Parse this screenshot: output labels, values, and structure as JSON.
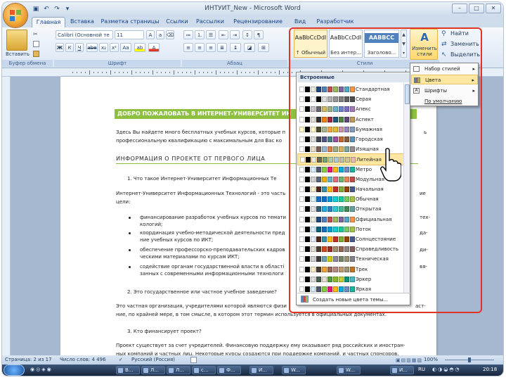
{
  "window": {
    "title": "ИНТУИТ_New - Microsoft Word"
  },
  "tabs": [
    "Главная",
    "Вставка",
    "Разметка страницы",
    "Ссылки",
    "Рассылки",
    "Рецензирование",
    "Вид",
    "Разработчик"
  ],
  "ribbon": {
    "paste_label": "Вставить",
    "clipboard_group": "Буфер обмена",
    "font_name": "Calibri (Основной те",
    "font_size": "11",
    "font_group": "Шрифт",
    "paragraph_group": "Абзац",
    "styles_group": "Стили",
    "styles": [
      {
        "preview": "AaBbCcDdI",
        "name": "↑ Обычный"
      },
      {
        "preview": "AaBbCcDdI",
        "name": "Без интер..."
      },
      {
        "preview": "AABBCC",
        "name": "Заголово..."
      }
    ],
    "change_styles_label": "Изменить стили",
    "find_label": "Найти",
    "replace_label": "Заменить",
    "select_label": "Выделить"
  },
  "document": {
    "banner": "ДОБРО ПОЖАЛОВАТЬ В ИНТЕРНЕТ-УНИВЕРСИТЕТ ИН",
    "banner_end": "ИЙ!",
    "intro_line1": "Здесь Вы найдете много бесплатных учебных курсов, которые п",
    "intro_line1_end": "ь",
    "intro_line2": "профессиональную квалификацию с максимальным для Вас ко",
    "heading": "ИНФОРМАЦИЯ О ПРОЕКТЕ ОТ ПЕРВОГО ЛИЦА",
    "q1": "1.      Что такое Интернет-Университет Информационных Те",
    "para1": "Интернет-Университет Информационных Технологий - это часть",
    "para1_end": "ие",
    "para1b": "цели:",
    "bullets": [
      "финансирование разработок учебных курсов по темати",
      "кологий;",
      "координация учебно-методической деятельности пред",
      "ние учебных курсов по ИКТ;",
      "обеспечение профессорско-преподавательских кадров",
      "ческими материалами по курсам ИКТ;",
      "содействие органам государственной власти в області",
      "занных с современными информационными технологи"
    ],
    "bullets_end": [
      "тех-",
      "да-",
      "ди-",
      "вя-"
    ],
    "q2": "2.      Это государственное или частное учебное заведение?",
    "para2": "Это частная организация, учредителями которой являются физи",
    "para2_end": "аст-",
    "para2b": "ние, по крайней мере, в том смысле, в котором этот термин используется в официальных документах.",
    "q3": "3.      Кто финансирует проект?",
    "para3": "Проект существует за счет учредителей. Финансовую поддержку ему оказывают ряд российских и иностран-",
    "para3b": "ных компаний и частных лиц. Некоторые курсы создаются при поддержке компаний, и частных спонсоров."
  },
  "theme_colors_menu": {
    "header": "Встроенные",
    "items": [
      {
        "name": "Стандартная",
        "colors": [
          "#ffffff",
          "#000000",
          "#eeece1",
          "#1f497d",
          "#4f81bd",
          "#c0504d",
          "#9bbb59",
          "#8064a2",
          "#4bacc6",
          "#f79646"
        ]
      },
      {
        "name": "Серая",
        "colors": [
          "#ffffff",
          "#000000",
          "#f8f8f8",
          "#000000",
          "#dddddd",
          "#b2b2b2",
          "#969696",
          "#808080",
          "#5f5f5f",
          "#4d4d4d"
        ]
      },
      {
        "name": "Апекс",
        "colors": [
          "#ffffff",
          "#000000",
          "#c9c2d1",
          "#69676d",
          "#ceb966",
          "#9cb084",
          "#6bb1c9",
          "#6585cf",
          "#7e6bc9",
          "#a379bb"
        ]
      },
      {
        "name": "Аспект",
        "colors": [
          "#ffffff",
          "#000000",
          "#e3ded1",
          "#323232",
          "#f07f09",
          "#9f2936",
          "#1b587c",
          "#4e8542",
          "#604878",
          "#c19859"
        ]
      },
      {
        "name": "Бумажная",
        "colors": [
          "#fefac9",
          "#000000",
          "#fefac9",
          "#444d26",
          "#a5b592",
          "#f3a447",
          "#e7bc29",
          "#d092a7",
          "#9c85c0",
          "#809ec2"
        ]
      },
      {
        "name": "Городская",
        "colors": [
          "#ffffff",
          "#000000",
          "#dedede",
          "#424456",
          "#53548a",
          "#438086",
          "#a04da3",
          "#c4652d",
          "#8b5d3d",
          "#5c92b5"
        ]
      },
      {
        "name": "Изящная",
        "colors": [
          "#ffffff",
          "#000000",
          "#ebddc3",
          "#775f55",
          "#94b6d2",
          "#dd8047",
          "#a5ab81",
          "#d8b25c",
          "#7ba79d",
          "#968c8c"
        ]
      },
      {
        "name": "Литейная",
        "colors": [
          "#ffffff",
          "#000000",
          "#eaebde",
          "#676a55",
          "#72a376",
          "#b0ccb0",
          "#a8cdd7",
          "#c0beaf",
          "#cec597",
          "#e8b7b7"
        ]
      },
      {
        "name": "Метро",
        "colors": [
          "#ffffff",
          "#000000",
          "#d6ecff",
          "#4e5b6f",
          "#7fd13b",
          "#ea157a",
          "#feb80a",
          "#00addc",
          "#738ac8",
          "#1ab39f"
        ]
      },
      {
        "name": "Модульная",
        "colors": [
          "#ffffff",
          "#000000",
          "#d4d4d4",
          "#5a6378",
          "#f0ad00",
          "#60b5cc",
          "#e66c7d",
          "#6bb76d",
          "#e88651",
          "#c64847"
        ]
      },
      {
        "name": "Начальная",
        "colors": [
          "#ffffff",
          "#000000",
          "#fbeec9",
          "#4f271c",
          "#3891a7",
          "#feb80a",
          "#c32d2e",
          "#84aa33",
          "#964305",
          "#475a8d"
        ]
      },
      {
        "name": "Обычная",
        "colors": [
          "#ffffff",
          "#000000",
          "#dbf5f9",
          "#0f6fc6",
          "#0f6fc6",
          "#009dd9",
          "#0bd0d9",
          "#10cf9b",
          "#7cca62",
          "#a5c249"
        ]
      },
      {
        "name": "Открытая",
        "colors": [
          "#ffffff",
          "#000000",
          "#dfe3e5",
          "#335b74",
          "#1cade4",
          "#2683c6",
          "#27ced7",
          "#42ba97",
          "#3e8853",
          "#62a39f"
        ]
      },
      {
        "name": "Официальная",
        "colors": [
          "#ffffff",
          "#000000",
          "#eeece1",
          "#1f497d",
          "#4f81bd",
          "#c0504d",
          "#9bbb59",
          "#8064a2",
          "#4bacc6",
          "#f79646"
        ]
      },
      {
        "name": "Поток",
        "colors": [
          "#ffffff",
          "#000000",
          "#dbefff",
          "#04617b",
          "#0f6fc6",
          "#009dd9",
          "#0bd0d9",
          "#10cf9b",
          "#7cca62",
          "#a5c249"
        ]
      },
      {
        "name": "Солнцестояние",
        "colors": [
          "#ffffff",
          "#000000",
          "#e6edf7",
          "#4f271c",
          "#3891a7",
          "#feb80a",
          "#c32d2e",
          "#84aa33",
          "#964305",
          "#475a8d"
        ]
      },
      {
        "name": "Справедливость",
        "colors": [
          "#ffffff",
          "#000000",
          "#e3ded1",
          "#4e3b30",
          "#d34817",
          "#9b2d1f",
          "#a28e6a",
          "#956251",
          "#918485",
          "#855d5d"
        ]
      },
      {
        "name": "Техническая",
        "colors": [
          "#ffffff",
          "#000000",
          "#d4d2d0",
          "#3b3b3b",
          "#6ea0b0",
          "#cccc00",
          "#8d89a4",
          "#748560",
          "#9e9273",
          "#7e848d"
        ]
      },
      {
        "name": "Трек",
        "colors": [
          "#ffffff",
          "#000000",
          "#fbeec9",
          "#4e3b30",
          "#f0a22e",
          "#a5644e",
          "#b58b80",
          "#c3986d",
          "#a19574",
          "#c17529"
        ]
      },
      {
        "name": "Эркер",
        "colors": [
          "#ffffff",
          "#000000",
          "#dedede",
          "#455f51",
          "#e3ded1",
          "#549e39",
          "#8ab833",
          "#c0cf3a",
          "#029676",
          "#4ab5c4"
        ]
      },
      {
        "name": "Яркая",
        "colors": [
          "#ffffff",
          "#000000",
          "#d6ecff",
          "#4e5b6f",
          "#7fd13b",
          "#ea157a",
          "#feb80a",
          "#00addc",
          "#738ac8",
          "#1ab39f"
        ]
      }
    ],
    "hover_index": 7,
    "footer": "Создать новые цвета темы..."
  },
  "change_styles_menu": {
    "items": [
      {
        "label": "Набор стилей",
        "arrow": "▸"
      },
      {
        "label": "Цвета",
        "arrow": "▸"
      },
      {
        "label": "Шрифты",
        "arrow": "▸"
      },
      {
        "label": "По умолчанию",
        "arrow": ""
      }
    ]
  },
  "statusbar": {
    "page": "Страница: 2 из 17",
    "words": "Число слов: 4 496",
    "language": "Русский (Россия)",
    "zoom": "100%"
  },
  "taskbar": {
    "buttons": [
      "В...",
      "Л...",
      "Л...",
      "с...",
      "Ф...",
      "И...",
      "W...",
      "W...",
      "И..."
    ],
    "lang": "RU",
    "clock": "20:18"
  },
  "accent": "#e03424"
}
